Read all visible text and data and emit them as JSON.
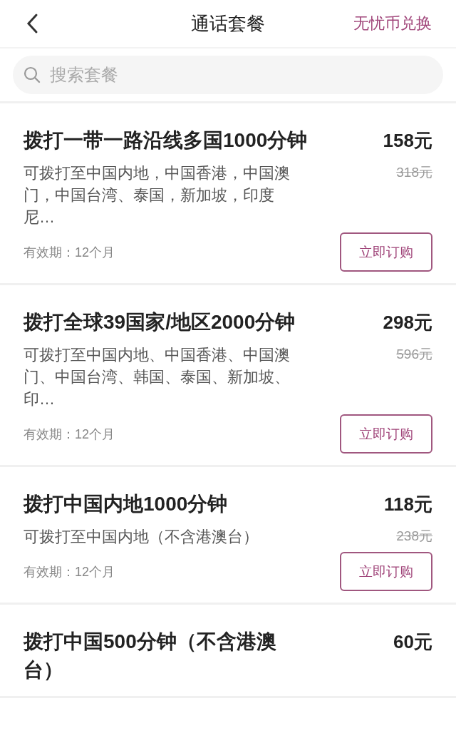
{
  "header": {
    "title": "通话套餐",
    "action": "无忧币兑换"
  },
  "search": {
    "placeholder": "搜索套餐"
  },
  "plans": [
    {
      "title": "拨打一带一路沿线多国1000分钟",
      "price": "158元",
      "original_price": "318元",
      "description": "可拨打至中国内地，中国香港，中国澳门，中国台湾、泰国，新加坡，印度尼…",
      "validity": "有效期：12个月",
      "button": "立即订购"
    },
    {
      "title": "拨打全球39国家/地区2000分钟",
      "price": "298元",
      "original_price": "596元",
      "description": "可拨打至中国内地、中国香港、中国澳门、中国台湾、韩国、泰国、新加坡、印…",
      "validity": "有效期：12个月",
      "button": "立即订购"
    },
    {
      "title": "拨打中国内地1000分钟",
      "price": "118元",
      "original_price": "238元",
      "description": "可拨打至中国内地（不含港澳台）",
      "validity": "有效期：12个月",
      "button": "立即订购"
    },
    {
      "title": "拨打中国500分钟（不含港澳台）",
      "price": "60元"
    }
  ]
}
